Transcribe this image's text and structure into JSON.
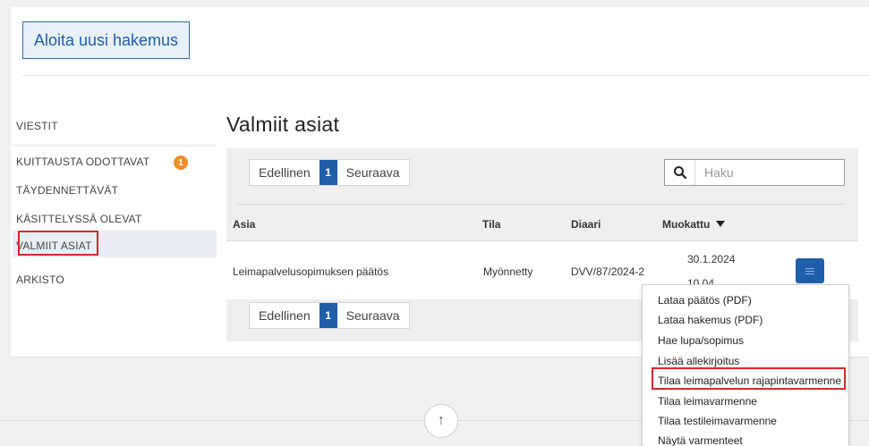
{
  "header": {
    "new_application_label": "Aloita uusi hakemus"
  },
  "sidebar": {
    "items": [
      {
        "label": "VIESTIT"
      },
      {
        "label": "KUITTAUSTA ODOTTAVAT",
        "badge": "1"
      },
      {
        "label": "TÄYDENNETTÄVÄT"
      },
      {
        "label": "KÄSITTELYSSÄ OLEVAT"
      },
      {
        "label": "VALMIIT ASIAT"
      },
      {
        "label": "ARKISTO"
      }
    ]
  },
  "main": {
    "title": "Valmiit asiat",
    "pager": {
      "prev": "Edellinen",
      "current": "1",
      "next": "Seuraava"
    },
    "search": {
      "placeholder": "Haku",
      "value": ""
    },
    "columns": [
      "Asia",
      "Tila",
      "Diaari",
      "Muokattu"
    ],
    "rows": [
      {
        "asia": "Leimapalvelusopimuksen päätös",
        "tila": "Myönnetty",
        "diaari": "DVV/87/2024-2",
        "muokattu_1": "30.1.2024",
        "muokattu_2": "10.04"
      }
    ]
  },
  "dropdown": {
    "items": [
      "Lataa päätös (PDF)",
      "Lataa hakemus (PDF)",
      "Hae lupa/sopimus",
      "Lisää allekirjoitus",
      "Tilaa leimapalvelun rajapintavarmenne",
      "Tilaa leimavarmenne",
      "Tilaa testileimavarmenne",
      "Näytä varmenteet"
    ]
  },
  "colors": {
    "accent": "#1f5faa",
    "badge": "#f08c2a",
    "highlight": "#d9262c"
  },
  "icons": {
    "search": "search-icon",
    "sort": "sort-desc-icon",
    "menu": "menu-icon",
    "scroll_top": "arrow-up-icon"
  }
}
